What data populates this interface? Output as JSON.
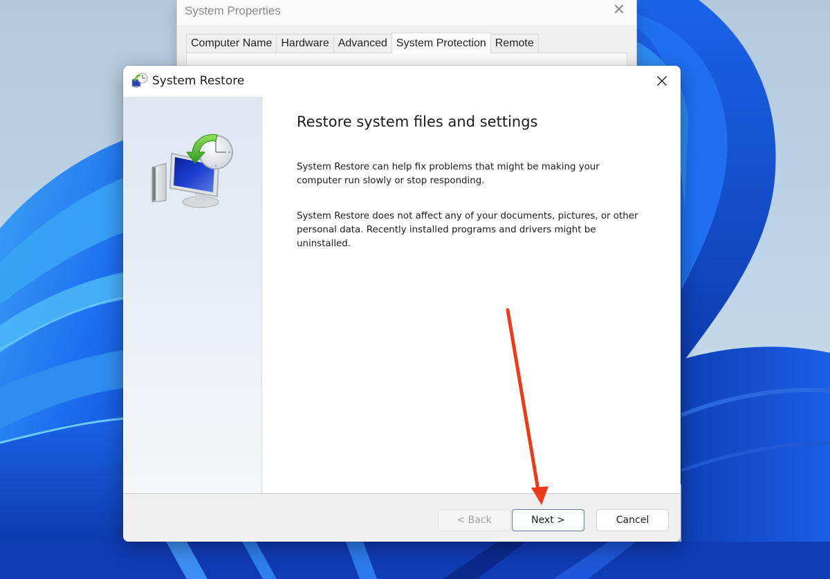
{
  "background_window": {
    "title": "System Properties",
    "close_icon": "close-icon",
    "tabs": [
      {
        "label": "Computer Name",
        "active": false
      },
      {
        "label": "Hardware",
        "active": false
      },
      {
        "label": "Advanced",
        "active": false
      },
      {
        "label": "System Protection",
        "active": true
      },
      {
        "label": "Remote",
        "active": false
      }
    ]
  },
  "dialog": {
    "title": "System Restore",
    "app_icon": "system-restore-icon",
    "close_icon": "close-icon",
    "sidebar_icon": "computer-clock-restore-icon",
    "heading": "Restore system files and settings",
    "paragraphs": [
      "System Restore can help fix problems that might be making your computer run slowly or stop responding.",
      "System Restore does not affect any of your documents, pictures, or other personal data. Recently installed programs and drivers might be uninstalled."
    ],
    "buttons": {
      "back": {
        "label": "< Back",
        "enabled": false
      },
      "next": {
        "label": "Next >",
        "enabled": true,
        "focused": true
      },
      "cancel": {
        "label": "Cancel",
        "enabled": true
      }
    }
  },
  "annotation": {
    "type": "arrow",
    "color": "#f03a17",
    "points_to": "next-button"
  },
  "colors": {
    "wallpaper_blue": "#1556e0",
    "wallpaper_sky": "#bcd3e6",
    "dialog_footer": "#f0f0f0",
    "sidebar": "#e3eaf4",
    "restore_green": "#5bc236"
  }
}
